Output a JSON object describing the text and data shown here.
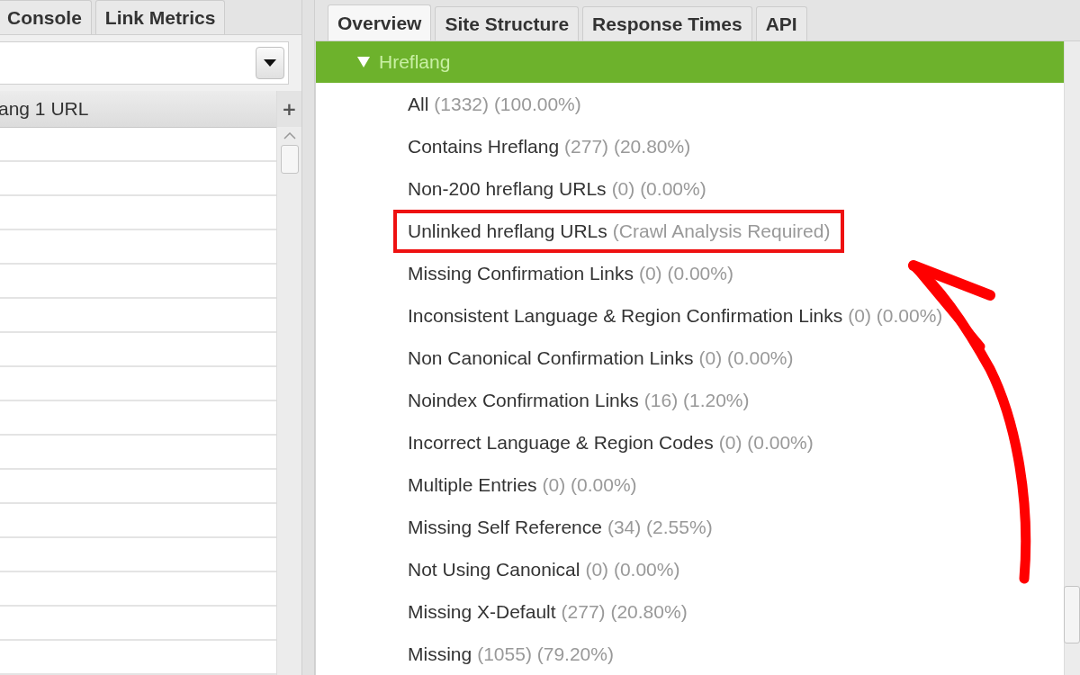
{
  "left_panel": {
    "tabs": [
      {
        "label": "Console",
        "selected": false
      },
      {
        "label": "Link Metrics",
        "selected": false
      }
    ],
    "table": {
      "columns": [
        "ang 1 URL"
      ],
      "add_column": "+"
    }
  },
  "right_panel": {
    "tabs": [
      {
        "label": "Overview",
        "selected": true
      },
      {
        "label": "Site Structure",
        "selected": false
      },
      {
        "label": "Response Times",
        "selected": false
      },
      {
        "label": "API",
        "selected": false
      }
    ],
    "tree": {
      "label": "Hreflang",
      "expanded": true,
      "selected": true,
      "children": [
        {
          "label": "All",
          "stats": "(1332) (100.00%)",
          "boxed": false
        },
        {
          "label": "Contains Hreflang",
          "stats": "(277) (20.80%)",
          "boxed": false
        },
        {
          "label": "Non-200 hreflang URLs",
          "stats": "(0) (0.00%)",
          "boxed": false
        },
        {
          "label": "Unlinked hreflang URLs",
          "stats": "(Crawl Analysis Required)",
          "boxed": true
        },
        {
          "label": "Missing Confirmation Links",
          "stats": "(0) (0.00%)",
          "boxed": false
        },
        {
          "label": "Inconsistent Language & Region Confirmation Links",
          "stats": "(0) (0.00%)",
          "boxed": false
        },
        {
          "label": "Non Canonical Confirmation Links",
          "stats": "(0) (0.00%)",
          "boxed": false
        },
        {
          "label": "Noindex Confirmation Links",
          "stats": "(16) (1.20%)",
          "boxed": false
        },
        {
          "label": "Incorrect Language & Region Codes",
          "stats": "(0) (0.00%)",
          "boxed": false
        },
        {
          "label": "Multiple Entries",
          "stats": "(0) (0.00%)",
          "boxed": false
        },
        {
          "label": "Missing Self Reference",
          "stats": "(34) (2.55%)",
          "boxed": false
        },
        {
          "label": "Not Using Canonical",
          "stats": "(0) (0.00%)",
          "boxed": false
        },
        {
          "label": "Missing X-Default",
          "stats": "(277) (20.80%)",
          "boxed": false
        },
        {
          "label": "Missing",
          "stats": "(1055) (79.20%)",
          "boxed": false
        }
      ]
    }
  }
}
